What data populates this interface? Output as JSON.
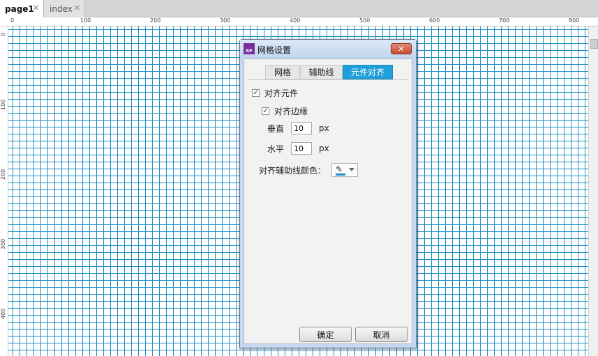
{
  "tabs": [
    {
      "label": "page1",
      "close": "✕"
    },
    {
      "label": "index",
      "close": "✕"
    }
  ],
  "ruler": {
    "top_labels": [
      "0",
      "100",
      "200",
      "300",
      "400",
      "500",
      "600",
      "700",
      "800"
    ],
    "left_labels": [
      "0",
      "100",
      "200",
      "300",
      "400"
    ]
  },
  "grid": {
    "line_color": "#1e8fc6"
  },
  "dialog": {
    "app_icon": "RP",
    "title": "网格设置",
    "close_label": "✕",
    "tabs": [
      {
        "label": "网格"
      },
      {
        "label": "辅助线"
      },
      {
        "label": "元件对齐",
        "active": true
      }
    ],
    "snap_widgets": {
      "label": "对齐元件",
      "checked": true
    },
    "snap_edges": {
      "label": "对齐边缘",
      "checked": true
    },
    "vertical": {
      "label": "垂直",
      "value": "10",
      "unit": "px"
    },
    "horizontal": {
      "label": "水平",
      "value": "10",
      "unit": "px"
    },
    "guide_color": {
      "label": "对齐辅助线颜色：",
      "icon": "pen-icon",
      "color": "#1e8fc6"
    },
    "ok_label": "确定",
    "cancel_label": "取消"
  }
}
